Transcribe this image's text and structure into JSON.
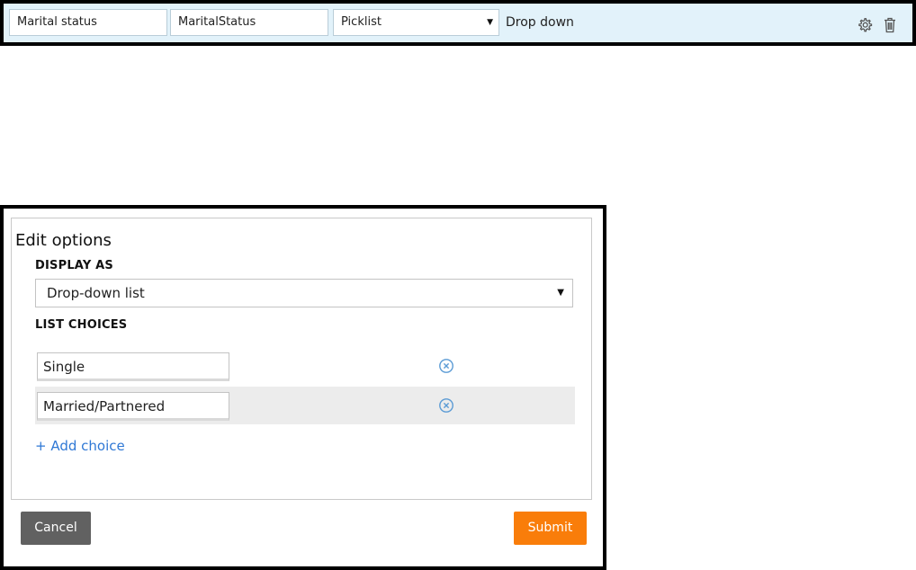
{
  "field_row": {
    "label_value": "Marital status",
    "name_value": "MaritalStatus",
    "type_value": "Picklist",
    "display_text": "Drop down",
    "icons": {
      "settings": "gear-icon",
      "delete": "trash-icon"
    }
  },
  "edit_options": {
    "title": "Edit options",
    "display_as": {
      "label": "DISPLAY AS",
      "value": "Drop-down list"
    },
    "list_choices": {
      "label": "LIST CHOICES",
      "choices": [
        {
          "value": "Single"
        },
        {
          "value": "Married/Partnered"
        }
      ],
      "remove_icon": "remove-circle-icon",
      "add_label": "+ Add choice"
    },
    "buttons": {
      "cancel": "Cancel",
      "submit": "Submit"
    }
  },
  "colors": {
    "row_background": "#e2f2fa",
    "link": "#2f78d5",
    "submit": "#f97d0a",
    "cancel": "#616161",
    "remove_icon": "#5b9bd5"
  }
}
